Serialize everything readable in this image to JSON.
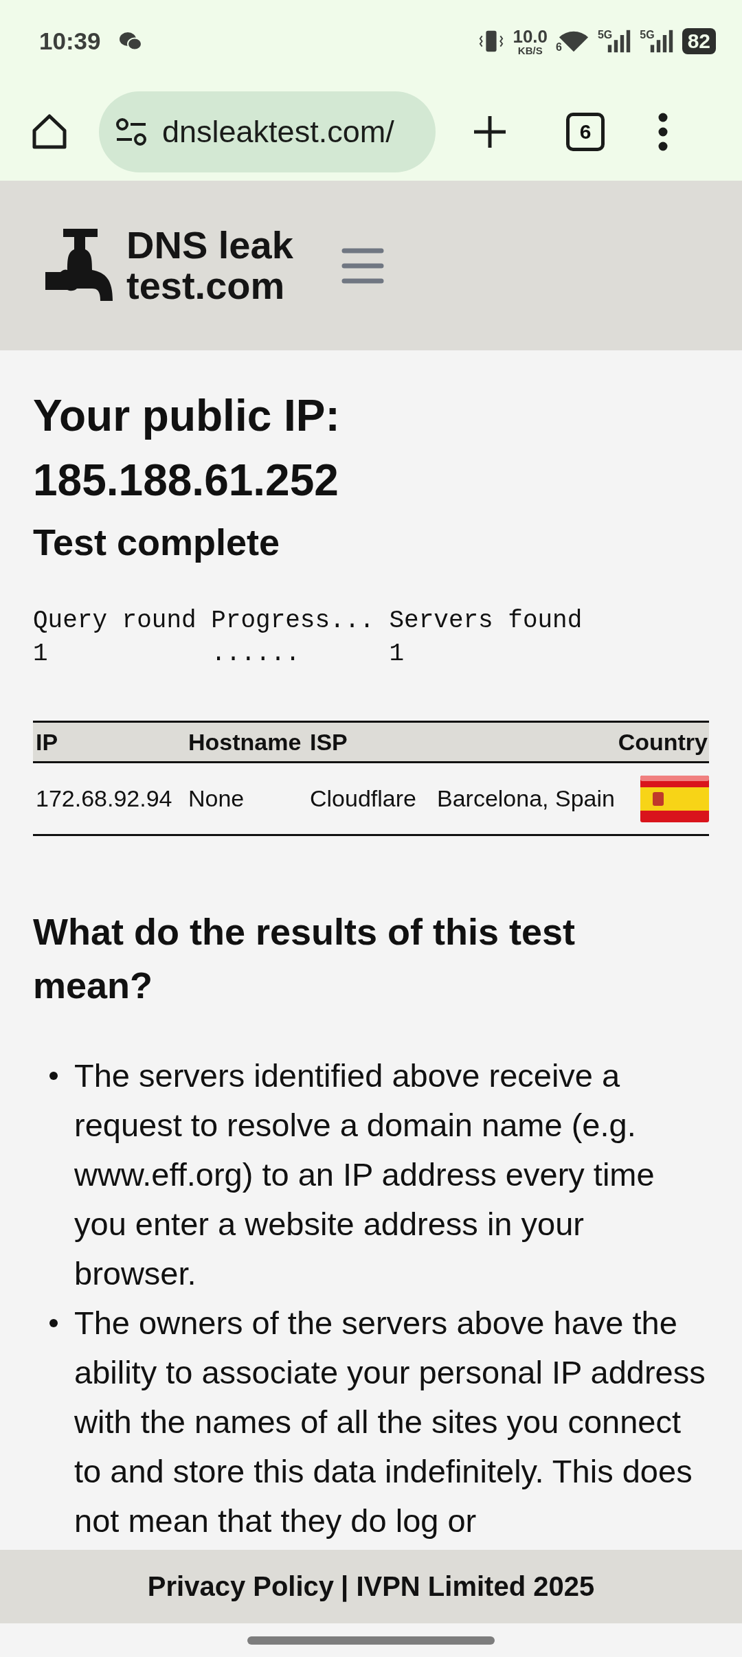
{
  "status_bar": {
    "time": "10:39",
    "network_speed": "10.0",
    "network_speed_unit": "KB/S",
    "wifi_label": "6",
    "signal_labels": [
      "5G",
      "5G"
    ],
    "battery": "82"
  },
  "browser": {
    "url": "dnsleaktest.com/",
    "tab_count": "6"
  },
  "site_header": {
    "logo_lines": [
      "DNS leak",
      "test.com"
    ]
  },
  "result": {
    "title": "Your public IP:",
    "ip": "185.188.61.252",
    "status": "Test complete"
  },
  "query_table": {
    "columns": [
      "Query round",
      "Progress...",
      "Servers found"
    ],
    "row": [
      "1",
      "......",
      "1"
    ]
  },
  "servers_table": {
    "columns": [
      "IP",
      "Hostname",
      "ISP",
      "Country"
    ],
    "rows": [
      {
        "ip": "172.68.92.94",
        "hostname": "None",
        "isp": "Cloudflare",
        "location": "Barcelona, Spain"
      }
    ]
  },
  "explanation": {
    "heading": "What do the results of this test mean?",
    "bullets": [
      "The servers identified above receive a request to resolve a domain name (e.g. www.eff.org) to an IP address every time you enter a website address in your browser.",
      "The owners of the servers above have the ability to associate your personal IP address with the names of all the sites you connect to and store this data indefinitely. This does not mean that they do log or"
    ]
  },
  "footer": {
    "link": "Privacy Policy",
    "text": "| IVPN Limited 2025"
  }
}
